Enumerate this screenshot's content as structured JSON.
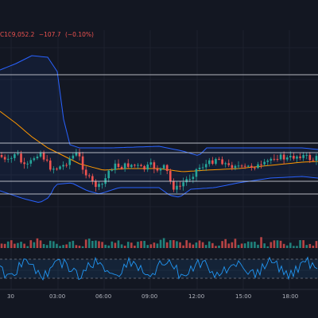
{
  "legend": {
    "close_label": "C",
    "close_value": "109,052.2",
    "change": "−107.7",
    "change_pct": "(−0.10%)"
  },
  "time_axis": [
    "30",
    "03:00",
    "06:00",
    "09:00",
    "12:00",
    "15:00",
    "18:00"
  ],
  "colors": {
    "background": "#131722",
    "up_candle": "#26a69a",
    "down_candle": "#ef5350",
    "bollinger": "#2962ff",
    "ma_line": "#ff9800",
    "oscillator": "#2196f3",
    "band_lines": "#d1d4dc"
  }
}
